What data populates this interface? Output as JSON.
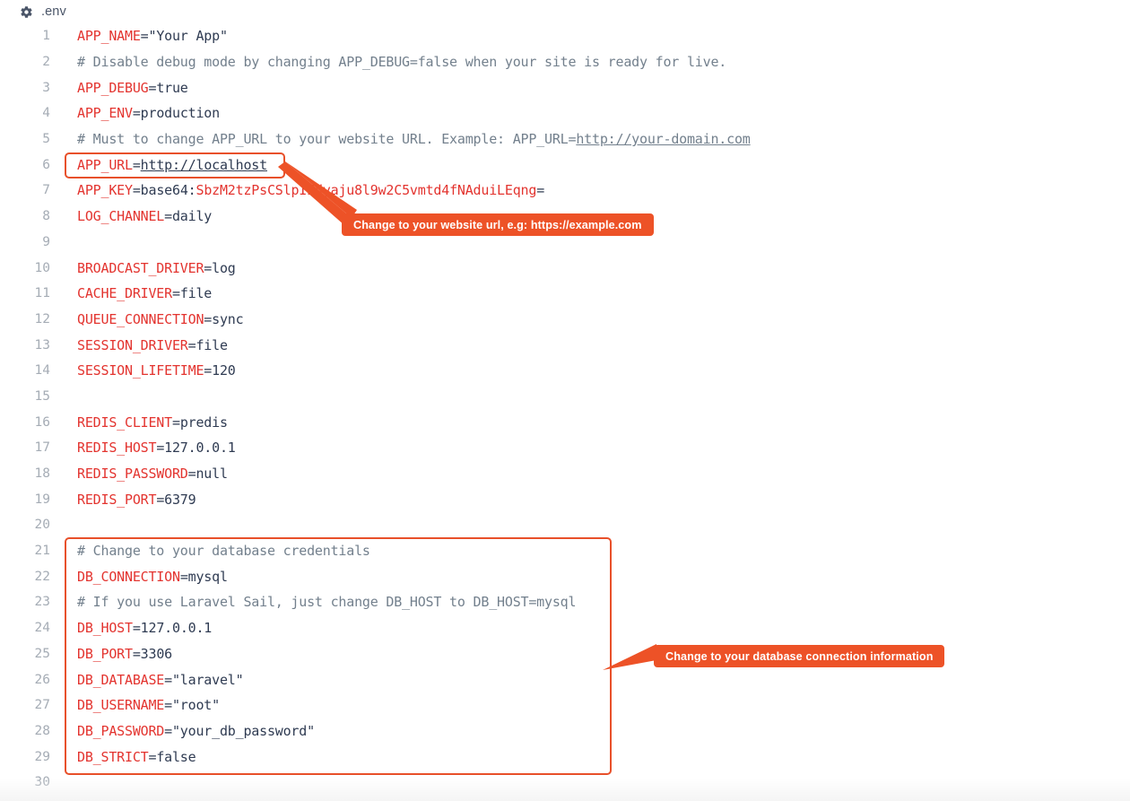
{
  "header": {
    "icon": "gear-icon",
    "file_name": ".env"
  },
  "editor": {
    "lines": [
      {
        "n": "1",
        "segs": [
          {
            "t": "APP_NAME",
            "c": "k"
          },
          {
            "t": "=\"Your App\"",
            "c": "v"
          }
        ]
      },
      {
        "n": "2",
        "segs": [
          {
            "t": "# Disable debug mode by changing APP_DEBUG=false when your site is ready for live.",
            "c": "cmt"
          }
        ]
      },
      {
        "n": "3",
        "segs": [
          {
            "t": "APP_DEBUG",
            "c": "k"
          },
          {
            "t": "=true",
            "c": "v"
          }
        ]
      },
      {
        "n": "4",
        "segs": [
          {
            "t": "APP_ENV",
            "c": "k"
          },
          {
            "t": "=production",
            "c": "v"
          }
        ]
      },
      {
        "n": "5",
        "segs": [
          {
            "t": "# Must to change APP_URL to your website URL. Example: APP_URL=",
            "c": "cmt"
          },
          {
            "t": "http://your-domain.com",
            "c": "lnk"
          }
        ]
      },
      {
        "n": "6",
        "segs": [
          {
            "t": "APP_URL",
            "c": "k"
          },
          {
            "t": "=",
            "c": "v"
          },
          {
            "t": "http://localhost",
            "c": "lnk2"
          }
        ]
      },
      {
        "n": "7",
        "segs": [
          {
            "t": "APP_KEY",
            "c": "k"
          },
          {
            "t": "=base64:",
            "c": "v"
          },
          {
            "t": "SbzM2tzPsCSlpIEdyaju8l9w2C5vmtd4fNAduiLEqng",
            "c": "k"
          },
          {
            "t": "=",
            "c": "v"
          }
        ]
      },
      {
        "n": "8",
        "segs": [
          {
            "t": "LOG_CHANNEL",
            "c": "k"
          },
          {
            "t": "=daily",
            "c": "v"
          }
        ]
      },
      {
        "n": "9",
        "segs": []
      },
      {
        "n": "10",
        "segs": [
          {
            "t": "BROADCAST_DRIVER",
            "c": "k"
          },
          {
            "t": "=log",
            "c": "v"
          }
        ]
      },
      {
        "n": "11",
        "segs": [
          {
            "t": "CACHE_DRIVER",
            "c": "k"
          },
          {
            "t": "=file",
            "c": "v"
          }
        ]
      },
      {
        "n": "12",
        "segs": [
          {
            "t": "QUEUE_CONNECTION",
            "c": "k"
          },
          {
            "t": "=sync",
            "c": "v"
          }
        ]
      },
      {
        "n": "13",
        "segs": [
          {
            "t": "SESSION_DRIVER",
            "c": "k"
          },
          {
            "t": "=file",
            "c": "v"
          }
        ]
      },
      {
        "n": "14",
        "segs": [
          {
            "t": "SESSION_LIFETIME",
            "c": "k"
          },
          {
            "t": "=120",
            "c": "v"
          }
        ]
      },
      {
        "n": "15",
        "segs": []
      },
      {
        "n": "16",
        "segs": [
          {
            "t": "REDIS_CLIENT",
            "c": "k"
          },
          {
            "t": "=predis",
            "c": "v"
          }
        ]
      },
      {
        "n": "17",
        "segs": [
          {
            "t": "REDIS_HOST",
            "c": "k"
          },
          {
            "t": "=127.0.0.1",
            "c": "v"
          }
        ]
      },
      {
        "n": "18",
        "segs": [
          {
            "t": "REDIS_PASSWORD",
            "c": "k"
          },
          {
            "t": "=null",
            "c": "v"
          }
        ]
      },
      {
        "n": "19",
        "segs": [
          {
            "t": "REDIS_PORT",
            "c": "k"
          },
          {
            "t": "=6379",
            "c": "v"
          }
        ]
      },
      {
        "n": "20",
        "segs": []
      },
      {
        "n": "21",
        "segs": [
          {
            "t": "# Change to your database credentials",
            "c": "cmt"
          }
        ]
      },
      {
        "n": "22",
        "segs": [
          {
            "t": "DB_CONNECTION",
            "c": "k"
          },
          {
            "t": "=mysql",
            "c": "v"
          }
        ]
      },
      {
        "n": "23",
        "segs": [
          {
            "t": "# If you use Laravel Sail, just change DB_HOST to DB_HOST=mysql",
            "c": "cmt"
          }
        ]
      },
      {
        "n": "24",
        "segs": [
          {
            "t": "DB_HOST",
            "c": "k"
          },
          {
            "t": "=127.0.0.1",
            "c": "v"
          }
        ]
      },
      {
        "n": "25",
        "segs": [
          {
            "t": "DB_PORT",
            "c": "k"
          },
          {
            "t": "=3306",
            "c": "v"
          }
        ]
      },
      {
        "n": "26",
        "segs": [
          {
            "t": "DB_DATABASE",
            "c": "k"
          },
          {
            "t": "=\"laravel\"",
            "c": "v"
          }
        ]
      },
      {
        "n": "27",
        "segs": [
          {
            "t": "DB_USERNAME",
            "c": "k"
          },
          {
            "t": "=\"root\"",
            "c": "v"
          }
        ]
      },
      {
        "n": "28",
        "segs": [
          {
            "t": "DB_PASSWORD",
            "c": "k"
          },
          {
            "t": "=\"your_db_password\"",
            "c": "v"
          }
        ]
      },
      {
        "n": "29",
        "segs": [
          {
            "t": "DB_STRICT",
            "c": "k"
          },
          {
            "t": "=false",
            "c": "v"
          }
        ]
      },
      {
        "n": "30",
        "segs": []
      }
    ]
  },
  "annotations": {
    "app_url_callout": "Change to your website url, e.g: https://example.com",
    "database_callout": "Change to your database connection information"
  },
  "colors": {
    "accent": "#ed5227",
    "key": "#e3342f",
    "value": "#2f3b52",
    "comment": "#73808d",
    "lineno": "#a5acb5",
    "background": "#ffffff"
  }
}
